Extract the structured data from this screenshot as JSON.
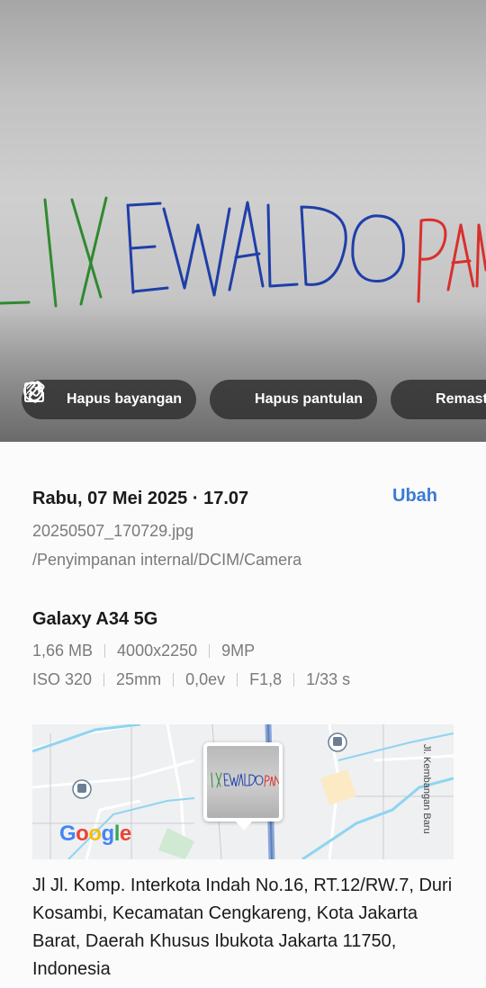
{
  "photo": {
    "handwriting": "LIXEWALDO PAN"
  },
  "actions": [
    {
      "label": "Hapus bayangan",
      "icon": "shadow-erase-icon"
    },
    {
      "label": "Hapus pantulan",
      "icon": "reflection-erase-icon"
    },
    {
      "label": "Remaster",
      "icon": "remaster-icon"
    }
  ],
  "details": {
    "datetime": "Rabu, 07 Mei 2025 · 17.07",
    "edit_label": "Ubah",
    "filename": "20250507_170729.jpg",
    "path": "/Penyimpanan internal/DCIM/Camera",
    "device": "Galaxy A34 5G",
    "specs_row1": [
      "1,66 MB",
      "4000x2250",
      "9MP"
    ],
    "specs_row2": [
      "ISO 320",
      "25mm",
      "0,0ev",
      "F1,8",
      "1/33 s"
    ]
  },
  "map": {
    "street_label": "Jl. Kembangan Baru",
    "logo": "Google"
  },
  "address": "Jl Jl. Komp. Interkota Indah No.16, RT.12/RW.7, Duri Kosambi, Kecamatan Cengkareng, Kota Jakarta Barat, Daerah Khusus Ibukota Jakarta 11750, Indonesia",
  "colors": {
    "accent": "#3a7bd5",
    "green_ink": "#2f8a2f",
    "blue_ink": "#1f3fa8",
    "red_ink": "#d8302d"
  }
}
